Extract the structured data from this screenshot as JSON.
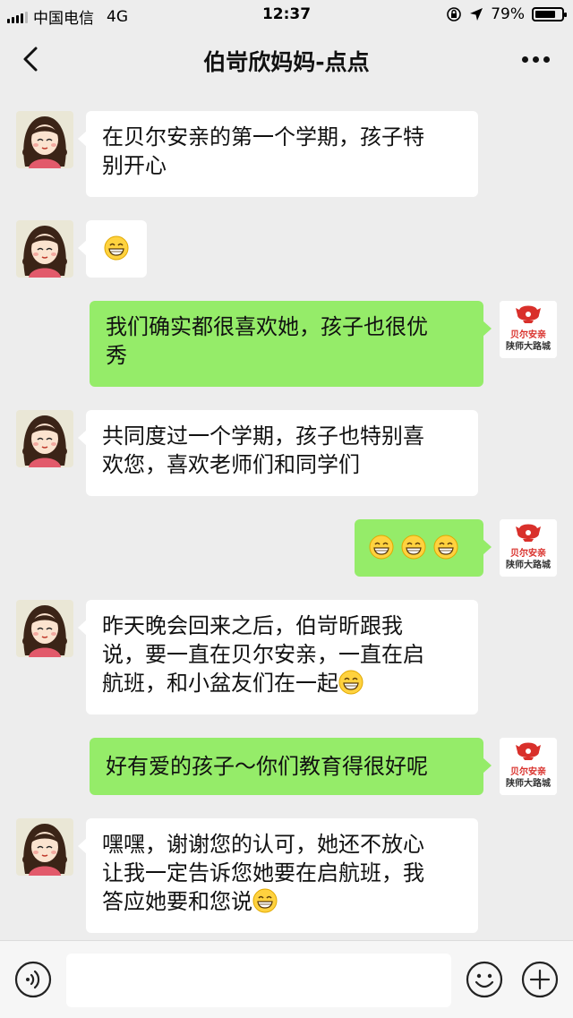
{
  "status_bar": {
    "carrier": "中国电信",
    "network": "4G",
    "time": "12:37",
    "battery": "79%",
    "battery_level": 0.79
  },
  "nav": {
    "title": "伯岢欣妈妈-点点"
  },
  "brand_avatar": {
    "line1": "贝尔安亲",
    "line2": "陕师大路城",
    "color": "#d9302b"
  },
  "messages": [
    {
      "side": "left",
      "text": "在贝尔安亲的第一个学期，孩子特别开心",
      "lines": [
        "在贝尔安亲的第一个学期，孩子特",
        "别开心"
      ]
    },
    {
      "side": "left",
      "emoji": "grin"
    },
    {
      "side": "right",
      "text": "我们确实都很喜欢她，孩子也很优秀",
      "lines": [
        "我们确实都很喜欢她，孩子也很优",
        "秀"
      ]
    },
    {
      "side": "left",
      "text": "共同度过一个学期，孩子也特别喜欢您，喜欢老师们和同学们",
      "lines": [
        "共同度过一个学期，孩子也特别喜",
        "欢您，喜欢老师们和同学们"
      ]
    },
    {
      "side": "right",
      "emoji": "grin-grin-grin"
    },
    {
      "side": "left",
      "text": "昨天晚会回来之后，伯岢昕跟我说，要一直在贝尔安亲，一直在启航班，和小盆友们在一起",
      "lines": [
        "昨天晚会回来之后，伯岢昕跟我",
        "说，要一直在贝尔安亲，一直在启",
        "航班，和小盆友们在一起"
      ]
    },
    {
      "side": "right",
      "text": "好有爱的孩子～你们教育得很好呢",
      "lines": [
        "好有爱的孩子～你们教育得很好呢"
      ]
    },
    {
      "side": "left",
      "text": "嘿嘿，谢谢您的认可，她还不放心让我一定告诉您她要在启航班，我答应她要和您说",
      "lines": [
        "嘿嘿，谢谢您的认可，她还不放心",
        "让我一定告诉您她要在启航班，我",
        "答应她要和您说"
      ]
    }
  ],
  "input_bar": {
    "voice_icon": "voice-icon",
    "emoji_icon": "emoji-icon",
    "plus_icon": "plus-icon",
    "text_value": ""
  },
  "colors": {
    "background": "#ededed",
    "self_bubble": "#95ec69",
    "other_bubble": "#ffffff"
  }
}
